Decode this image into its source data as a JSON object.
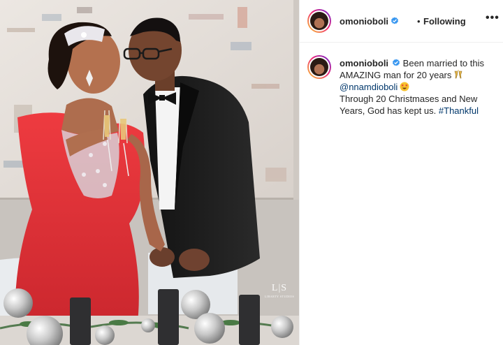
{
  "post": {
    "username": "omonioboli",
    "following_label": "Following",
    "separator": "•",
    "more_label": "•••",
    "watermark": {
      "logo": "L|S",
      "studio": "LIBARTY STUDIOS"
    }
  },
  "caption": {
    "username": "omonioboli",
    "line1": "Been married to this AMAZING man for 20 years",
    "mention": "@nnamdioboli",
    "line2": "Through 20 Christmases and New Years, God has kept us.",
    "hashtag": "#Thankful"
  },
  "icons": {
    "verified": "verified-badge-icon",
    "emoji1": "clinking-glasses-emoji",
    "emoji2": "star-struck-emoji",
    "more": "more-options-icon"
  },
  "colors": {
    "verified_blue": "#3897f0",
    "link": "#00376b",
    "dress_red": "#e0343a"
  }
}
